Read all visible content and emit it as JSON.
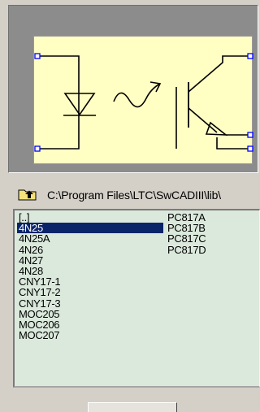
{
  "path_bar": {
    "path": "C:\\Program Files\\LTC\\SwCADIII\\lib\\"
  },
  "component_list": {
    "column_1": [
      "[..]",
      "4N25",
      "4N25A",
      "4N26",
      "4N27",
      "4N28",
      "CNY17-1",
      "CNY17-2",
      "CNY17-3",
      "MOC205",
      "MOC206",
      "MOC207"
    ],
    "column_2": [
      "PC817A",
      "PC817B",
      "PC817C",
      "PC817D"
    ],
    "selected": "4N25"
  },
  "colors": {
    "window_bg": "#d4d0c8",
    "preview_bg": "#8c8c8c",
    "symbol_bg": "#ffffc4",
    "list_bg": "#dbe9dc",
    "selection": "#0a246a",
    "pin_marker": "#0000ff"
  },
  "icons": {
    "path_bar": "folder-up-icon",
    "symbol": "optocoupler-symbol"
  }
}
